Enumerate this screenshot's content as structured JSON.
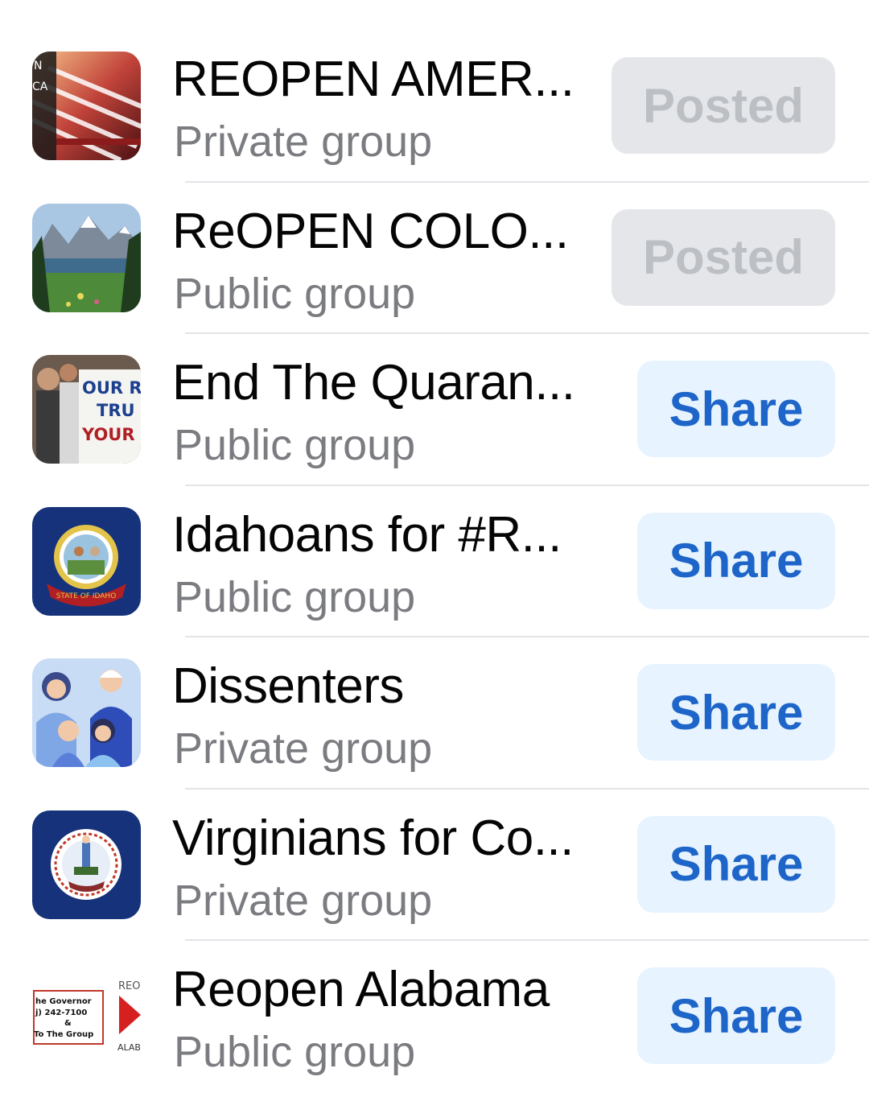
{
  "groups": [
    {
      "name": "REOPEN AMER...",
      "privacy": "Private group",
      "action": "Posted",
      "action_state": "posted",
      "thumbnail": "american-flag-image"
    },
    {
      "name": "ReOPEN COLO...",
      "privacy": "Public group",
      "action": "Posted",
      "action_state": "posted",
      "thumbnail": "mountain-lake-image"
    },
    {
      "name": "End The Quaran...",
      "privacy": "Public group",
      "action": "Share",
      "action_state": "share",
      "thumbnail": "protest-sign-image",
      "thumbnail_text": [
        "OUR RI",
        "TRU",
        "YOUR"
      ]
    },
    {
      "name": "Idahoans for #R...",
      "privacy": "Public group",
      "action": "Share",
      "action_state": "share",
      "thumbnail": "idaho-state-seal-image",
      "thumbnail_text": [
        "STATE OF IDAHO"
      ]
    },
    {
      "name": "Dissenters",
      "privacy": "Private group",
      "action": "Share",
      "action_state": "share",
      "thumbnail": "people-illustration-image"
    },
    {
      "name": "Virginians for Co...",
      "privacy": "Private group",
      "action": "Share",
      "action_state": "share",
      "thumbnail": "virginia-state-seal-image"
    },
    {
      "name": "Reopen Alabama",
      "privacy": "Public group",
      "action": "Share",
      "action_state": "share",
      "thumbnail": "alabama-flyer-image",
      "thumbnail_text": [
        "he Governor",
        "j) 242-7100",
        "&",
        "To The Group",
        "REO",
        "ALAB"
      ]
    }
  ],
  "colors": {
    "share_bg": "#e7f3ff",
    "share_text": "#1d65c8",
    "posted_bg": "#e4e6ea",
    "posted_text": "#bcc0c4",
    "title": "#050505",
    "subtitle": "#7a7c80",
    "separator": "#e3e4e8"
  }
}
